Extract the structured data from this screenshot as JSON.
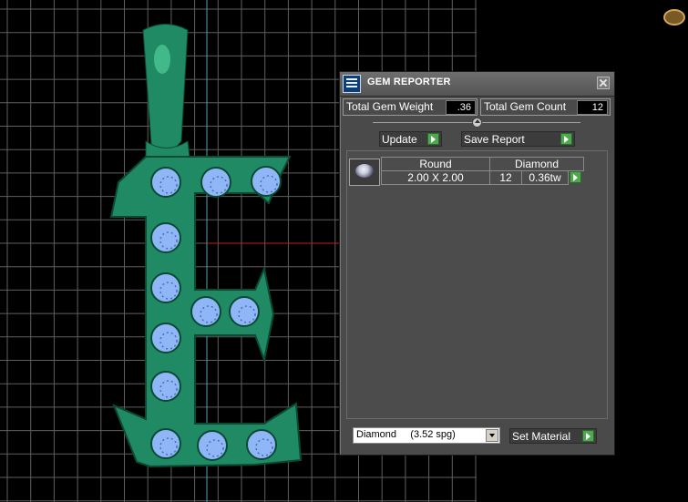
{
  "colors": {
    "background": "#000000",
    "grid": "#777777",
    "pendant": "#1f8a64",
    "gem": "#8fb7f7",
    "panel": "#4a4a4a",
    "accent_button": "#4fa84f"
  },
  "icons": {
    "app": "gem-reporter-icon",
    "close": "close-icon",
    "play": "play-arrow-icon",
    "corner": "gem-cursor-icon"
  },
  "gem_reporter": {
    "title": "GEM REPORTER",
    "total_weight_label": "Total Gem Weight",
    "total_weight_value": ".36",
    "total_count_label": "Total Gem Count",
    "total_count_value": "12",
    "update_label": "Update",
    "save_report_label": "Save Report",
    "table": {
      "shape_header": "Round",
      "material_header": "Diamond",
      "size": "2.00 X 2.00",
      "count": "12",
      "weight": "0.36tw"
    },
    "material_select": "Diamond     (3.52 spg)",
    "set_material_label": "Set Material"
  }
}
